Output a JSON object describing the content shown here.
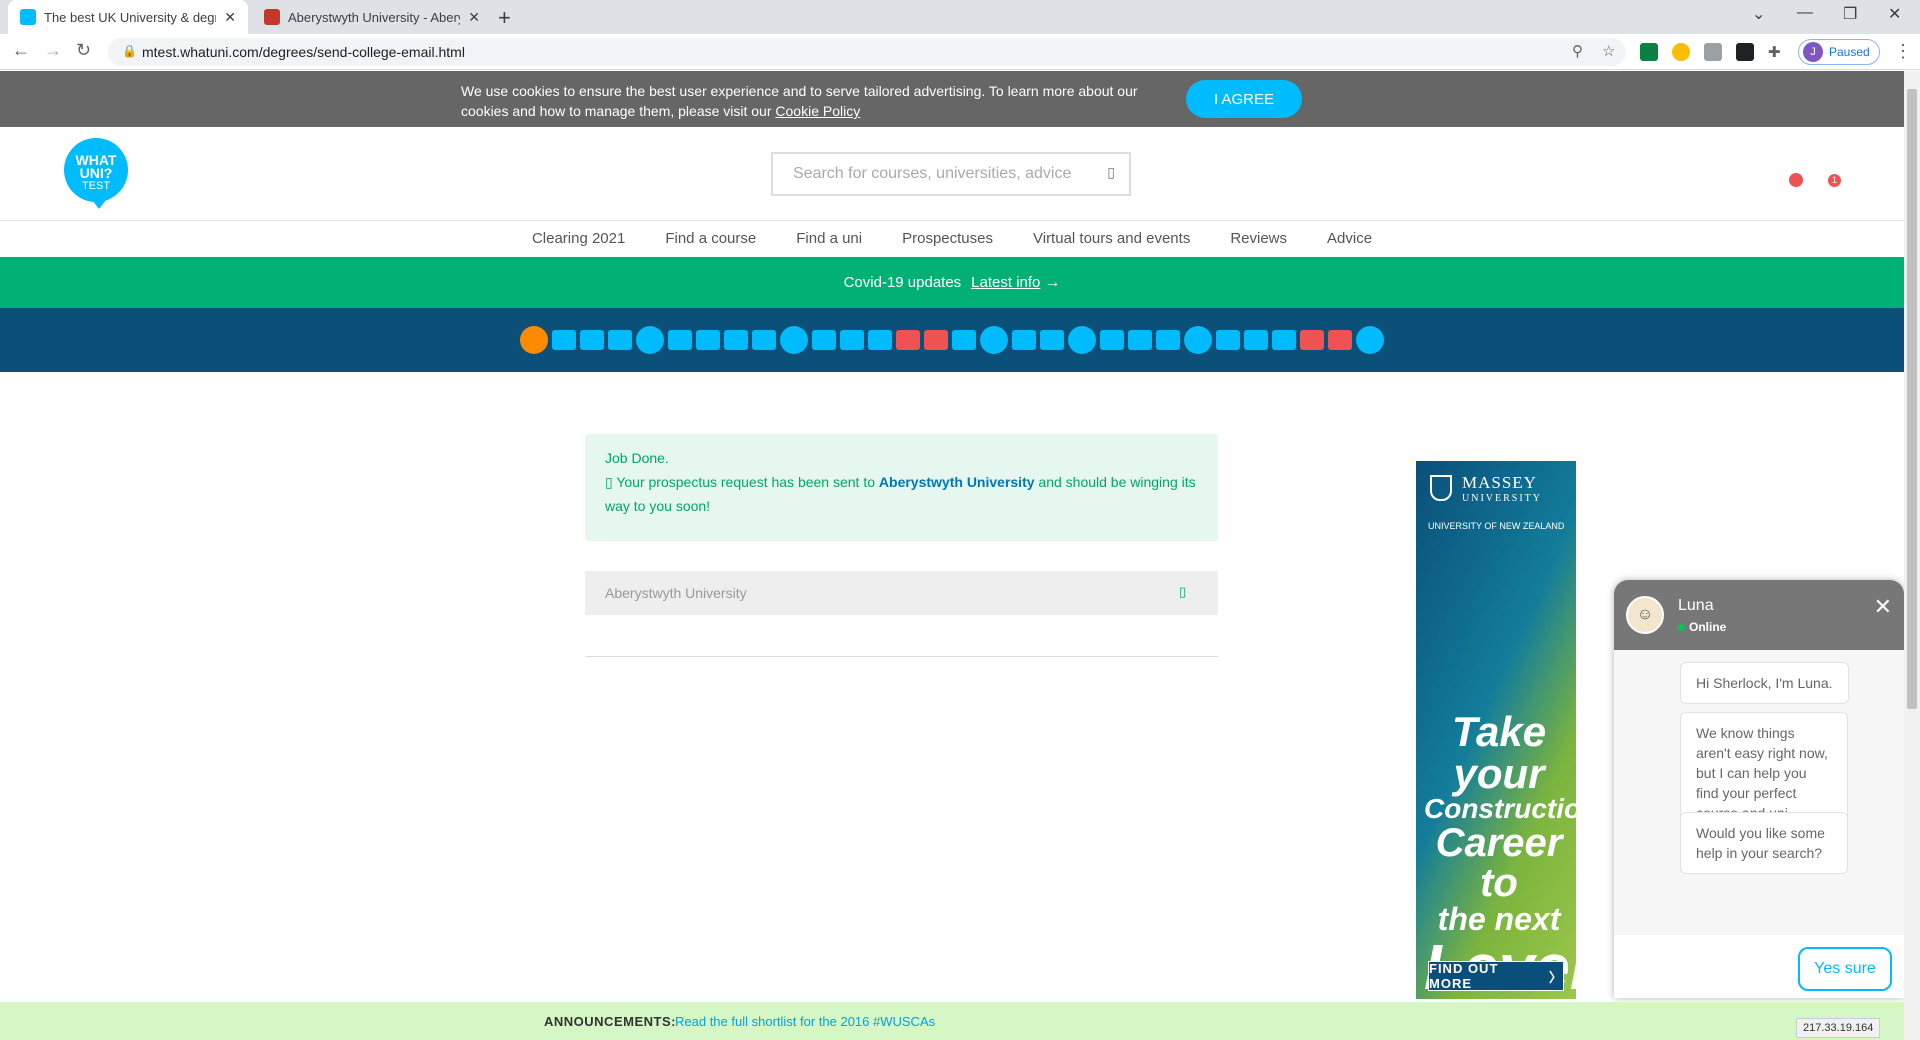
{
  "browser": {
    "tabs": [
      {
        "title": "The best UK University & degree",
        "active": true
      },
      {
        "title": "Aberystwyth University - Aberyst",
        "active": false
      }
    ],
    "url": "mtest.whatuni.com/degrees/send-college-email.html",
    "profile_initial": "J",
    "profile_status": "Paused"
  },
  "cookie": {
    "text": "We use cookies to ensure the best user experience and to serve tailored advertising. To learn more about our cookies and how to manage them, please visit our ",
    "link": "Cookie Policy",
    "agree": "I AGREE"
  },
  "header": {
    "logo_line1": "WHAT",
    "logo_line2": "UNI?",
    "logo_line3": "TEST",
    "search_placeholder": "Search for courses, universities, advice",
    "badge_count": "1"
  },
  "nav": [
    "Clearing 2021",
    "Find a course",
    "Find a uni",
    "Prospectuses",
    "Virtual tours and events",
    "Reviews",
    "Advice"
  ],
  "covid": {
    "label": "Covid-19 updates",
    "link": "Latest info"
  },
  "success": {
    "title": "Job Done.",
    "pre": "Your prospectus request has been sent to ",
    "university": "Aberystwyth University",
    "post": " and should be winging its way to you soon!"
  },
  "selected_university": "Aberystwyth University",
  "ad": {
    "brand": "MASSEY",
    "brand_sub": "UNIVERSITY",
    "tagline": "UNIVERSITY OF NEW ZEALAND",
    "headline": [
      "Take your",
      "Construction",
      "Career to",
      "the next",
      "Level"
    ],
    "cta": "FIND OUT MORE"
  },
  "chat": {
    "name": "Luna",
    "status": "Online",
    "messages": [
      "Hi Sherlock, I'm Luna.",
      "We know things aren't easy right now, but I can help you find your perfect course and uni.",
      "Would you like some help in your search?"
    ],
    "reply": "Yes sure"
  },
  "announcement": {
    "label": "ANNOUNCEMENTS:",
    "link": "Read the full shortlist for the 2016 #WUSCAs"
  },
  "status_ip": "217.33.19.164",
  "colors": {
    "accent": "#00bbfd",
    "covid_green": "#00b074",
    "progress_bar": "#0a5078",
    "alert_red": "#ee5253"
  }
}
